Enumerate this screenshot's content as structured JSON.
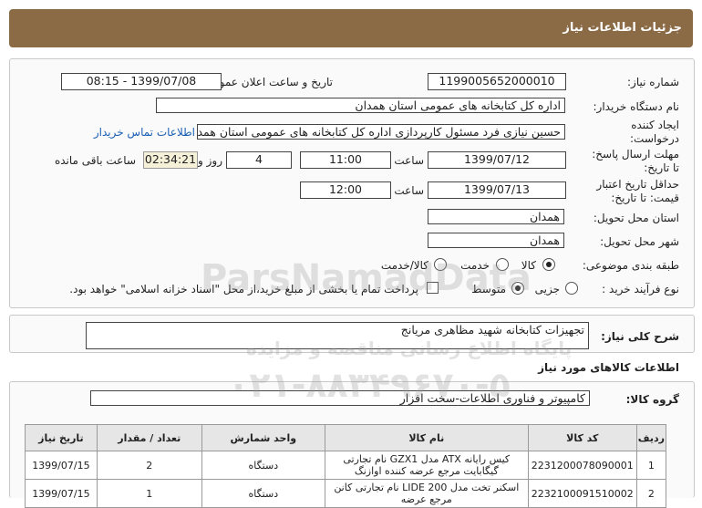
{
  "header": {
    "title": "جزئیات اطلاعات نیاز"
  },
  "form": {
    "need_number_label": "شماره نیاز:",
    "need_number": "1199005652000010",
    "announce_label": "تاریخ و ساعت اعلان عمومی:",
    "announce_value": "1399/07/08 - 08:15",
    "buyer_label": "نام دستگاه خریدار:",
    "buyer_value": "اداره کل کتابخانه های عمومی استان همدان",
    "creator_label_1": "ایجاد کننده",
    "creator_label_2": "درخواست:",
    "creator_value": "حسین نیازی فرد مسئول کارپردازی اداره کل کتابخانه های عمومی استان همدان",
    "contact_link": "اطلاعات تماس خریدار",
    "deadline_label_1": "مهلت ارسال پاسخ:",
    "deadline_label_2": "تا تاریخ:",
    "deadline_date": "1399/07/12",
    "time_label": "ساعت",
    "deadline_time": "11:00",
    "days_value": "4",
    "days_label": "روز و",
    "remaining_time": "02:34:21",
    "remaining_label": "ساعت باقی مانده",
    "validity_label_1": "حداقل تاریخ اعتبار",
    "validity_label_2": "قیمت: تا تاریخ:",
    "validity_date": "1399/07/13",
    "validity_time": "12:00",
    "province_label": "استان محل تحویل:",
    "province_value": "همدان",
    "city_label": "شهر محل تحویل:",
    "city_value": "همدان",
    "category_label": "طبقه بندی موضوعی:",
    "category_options": [
      "کالا",
      "خدمت",
      "کالا/خدمت"
    ],
    "category_selected": "کالا",
    "process_label": "نوع فرآیند خرید :",
    "process_options": [
      "جزیی",
      "متوسط"
    ],
    "process_selected": "متوسط",
    "payment_note": "پرداخت تمام یا بخشی از مبلغ خرید،از محل \"اسناد خزانه اسلامی\" خواهد بود."
  },
  "description": {
    "label": "شرح کلی نیاز:",
    "value": "تجهیزات کتابخانه شهید مظاهری مریانج"
  },
  "goods_info": {
    "title": "اطلاعات کالاهای مورد نیاز",
    "group_label": "گروه کالا:",
    "group_value": "کامپیوتر و فناوری اطلاعات-سخت افزار"
  },
  "table": {
    "headers": [
      "ردیف",
      "کد کالا",
      "نام کالا",
      "واحد شمارش",
      "تعداد / مقدار",
      "تاریخ نیاز"
    ],
    "rows": [
      [
        "1",
        "2231200078090001",
        "کیس رایانه ATX مدل GZX1 نام تجارتی گیگابایت مرجع عرضه کننده اوازنگ",
        "دستگاه",
        "2",
        "1399/07/15"
      ],
      [
        "2",
        "2232100091510002",
        "اسکنر تخت مدل LIDE 200 نام تجارتی کانن مرجع عرضه",
        "دستگاه",
        "1",
        "1399/07/15"
      ]
    ]
  },
  "watermark": {
    "line1": "ParsNamadData",
    "line2": "پایگاه اطلاع رسانی مناقصه و مزایده",
    "line3": "۰۲۱-۸۸۳۴۹۶۷۰-۵"
  }
}
